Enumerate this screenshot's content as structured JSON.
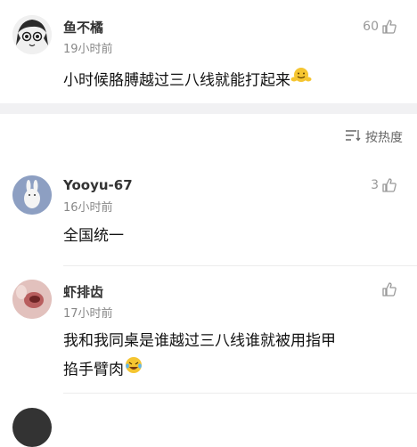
{
  "comments": [
    {
      "username": "鱼不橘",
      "time": "19小时前",
      "text": "小时候胳膊越过三八线就能打起来",
      "likes": "60"
    },
    {
      "username": "Yooyu-67",
      "time": "16小时前",
      "text": "全国统一",
      "likes": "3"
    },
    {
      "username": "虾排齿",
      "time": "17小时前",
      "text_line1": "我和我同桌是谁越过三八线谁就被用指甲",
      "text_line2": "掐手臂肉",
      "likes": ""
    }
  ],
  "sort": {
    "label": "按热度"
  },
  "icons": {
    "like": "thumbs-up-icon",
    "sort": "sort-lines-icon"
  },
  "colors": {
    "divider": "#f1f1f3",
    "muted": "#888888"
  }
}
